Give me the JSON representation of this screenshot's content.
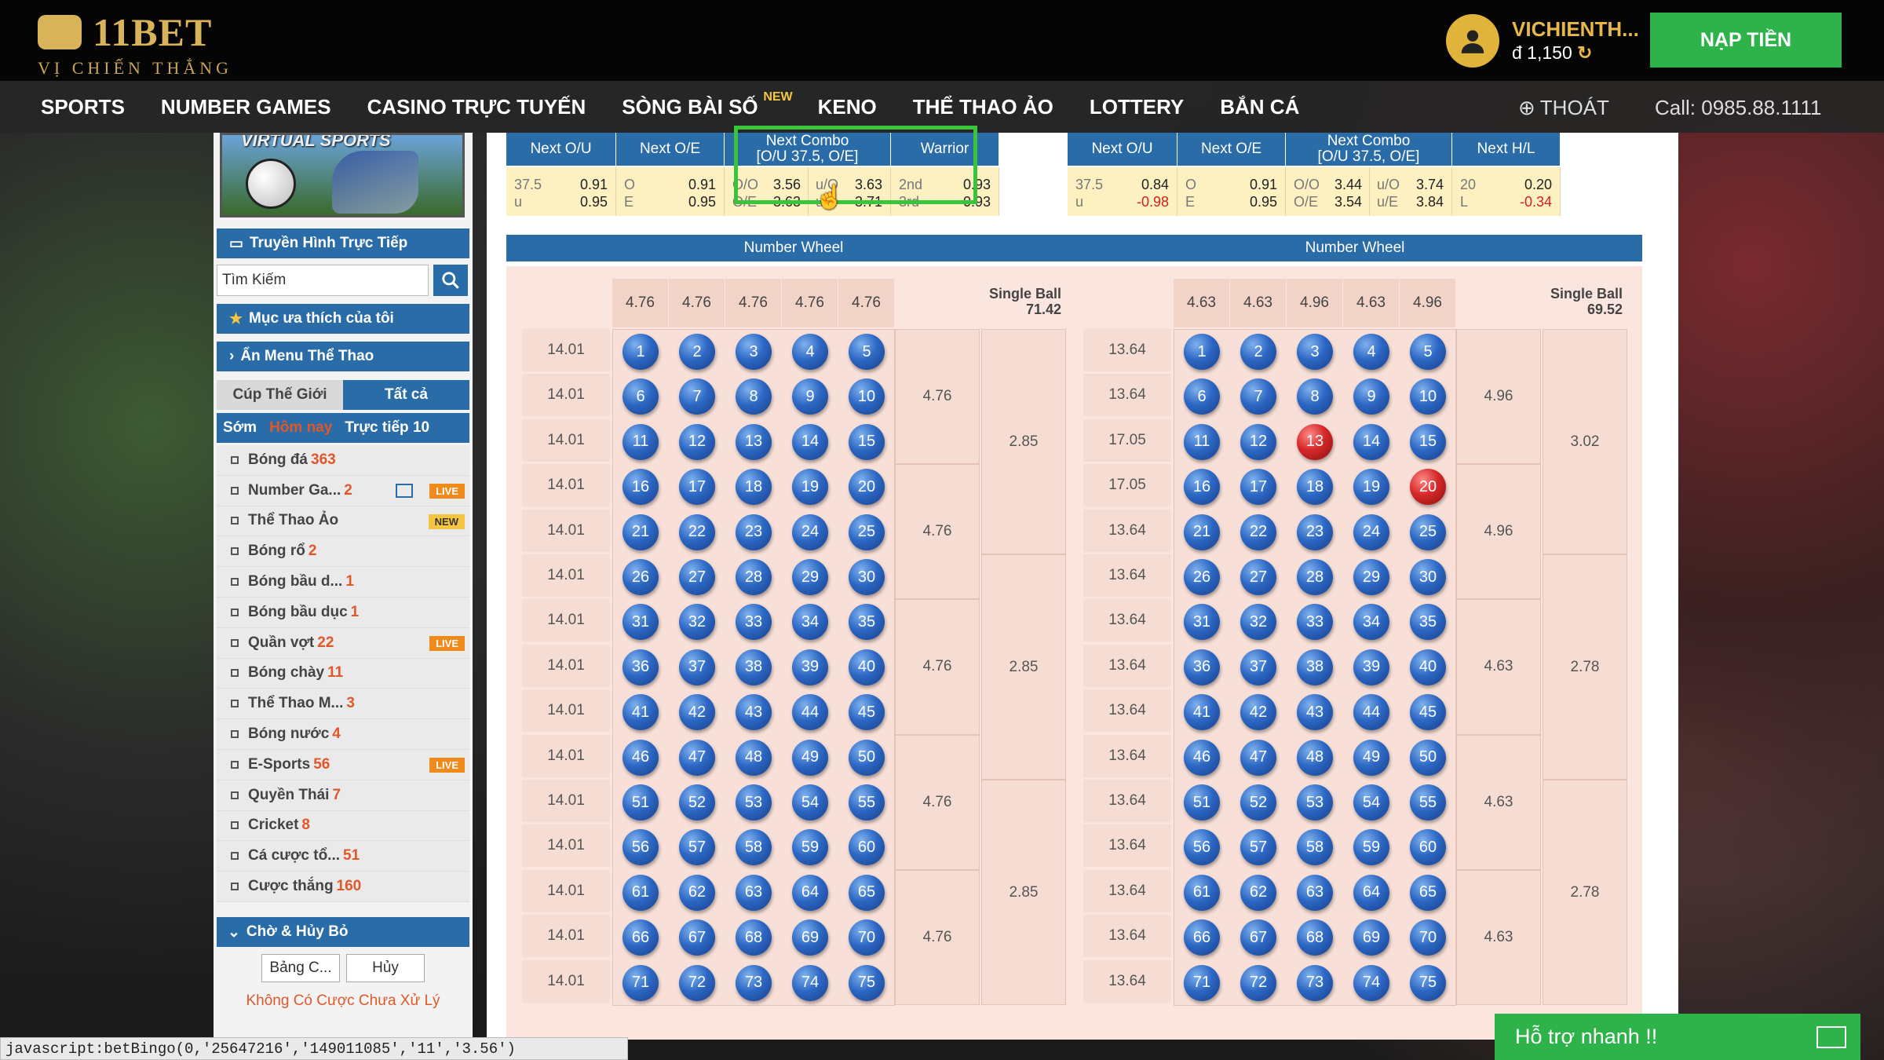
{
  "brand": {
    "name": "11BET",
    "tagline": "VỊ CHIẾN THẮNG"
  },
  "user": {
    "name": "VICHIENTH...",
    "balance": "đ 1,150"
  },
  "deposit_label": "NẠP TIỀN",
  "nav": {
    "items": [
      "SPORTS",
      "NUMBER GAMES",
      "CASINO TRỰC TUYẾN",
      "SÒNG BÀI SỐ",
      "KENO",
      "THỂ THAO ẢO",
      "LOTTERY",
      "BẮN CÁ"
    ],
    "new_badge": "NEW",
    "logout": "THOÁT",
    "call": "Call: 0985.88.1111"
  },
  "sidebar": {
    "banner_title": "VIRTUAL SPORTS",
    "live_tv": "Truyền Hình Trực Tiếp",
    "search_placeholder": "Tìm Kiếm",
    "favorites": "Mục ưa thích của tôi",
    "hide_menu": "Ẩn Menu Thể Thao",
    "tabs": [
      "Cúp Thế Giới",
      "Tất cả"
    ],
    "sub_tabs": [
      "Sớm",
      "Hôm nay",
      "Trực tiếp 10"
    ],
    "sports": [
      {
        "name": "Bóng đá",
        "count": "363",
        "badge": ""
      },
      {
        "name": "Number Ga...",
        "count": "2",
        "badge": "LIVE",
        "cal": true
      },
      {
        "name": "Thể Thao Ảo",
        "count": "",
        "badge": "NEW"
      },
      {
        "name": "Bóng rổ",
        "count": "2",
        "badge": ""
      },
      {
        "name": "Bóng bầu d...",
        "count": "1",
        "badge": ""
      },
      {
        "name": "Bóng bầu dục",
        "count": "1",
        "badge": ""
      },
      {
        "name": "Quần vợt",
        "count": "22",
        "badge": "LIVE"
      },
      {
        "name": "Bóng chày",
        "count": "11",
        "badge": ""
      },
      {
        "name": "Thể Thao M...",
        "count": "3",
        "badge": ""
      },
      {
        "name": "Bóng nước",
        "count": "4",
        "badge": ""
      },
      {
        "name": "E-Sports",
        "count": "56",
        "badge": "LIVE"
      },
      {
        "name": "Quyền Thái",
        "count": "7",
        "badge": ""
      },
      {
        "name": "Cricket",
        "count": "8",
        "badge": ""
      },
      {
        "name": "Cá cược tổ...",
        "count": "51",
        "badge": ""
      },
      {
        "name": "Cược thắng",
        "count": "160",
        "badge": ""
      }
    ],
    "pending_title": "Chờ & Hủy Bỏ",
    "pending_buttons": [
      "Bảng C...",
      "Hủy"
    ],
    "pending_msg": "Không Có Cược Chưa Xử Lý"
  },
  "panels": [
    {
      "headers": [
        "Next O/U",
        "Next O/E",
        "Next Combo\n[O/U 37.5, O/E]",
        "Warrior"
      ],
      "odds": [
        {
          "l": [
            "37.5",
            "u"
          ],
          "r": [
            "0.91",
            "0.95"
          ]
        },
        {
          "l": [
            "O",
            "E"
          ],
          "r": [
            "0.91",
            "0.95"
          ]
        },
        {
          "l": [
            "O/O",
            "O/E"
          ],
          "r": [
            "3.56",
            "3.63"
          ],
          "l2": [
            "u/O",
            "u/E"
          ],
          "r2": [
            "3.63",
            "3.71"
          ]
        },
        {
          "l": [
            "2nd",
            "3rd"
          ],
          "r": [
            "0.93",
            "0.93"
          ]
        }
      ],
      "wheel_title": "Number Wheel",
      "col_odds": [
        "4.76",
        "4.76",
        "4.76",
        "4.76",
        "4.76"
      ],
      "single_ball_label": "Single Ball",
      "single_ball": "71.42",
      "row_odds": [
        "14.01",
        "14.01",
        "14.01",
        "14.01",
        "14.01",
        "14.01",
        "14.01",
        "14.01",
        "14.01",
        "14.01",
        "14.01",
        "14.01",
        "14.01",
        "14.01",
        "14.01"
      ],
      "group_odds": [
        "4.76",
        "4.76",
        "4.76",
        "4.76",
        "4.76"
      ],
      "big_odds": [
        "2.85",
        "2.85",
        "2.85"
      ],
      "red_balls": []
    },
    {
      "headers": [
        "Next O/U",
        "Next O/E",
        "Next Combo\n[O/U 37.5, O/E]",
        "Next H/L"
      ],
      "odds": [
        {
          "l": [
            "37.5",
            "u"
          ],
          "r": [
            "0.84",
            "-0.98"
          ],
          "neg2": true
        },
        {
          "l": [
            "O",
            "E"
          ],
          "r": [
            "0.91",
            "0.95"
          ]
        },
        {
          "l": [
            "O/O",
            "O/E"
          ],
          "r": [
            "3.44",
            "3.54"
          ],
          "l2": [
            "u/O",
            "u/E"
          ],
          "r2": [
            "3.74",
            "3.84"
          ]
        },
        {
          "l": [
            "20",
            "L"
          ],
          "r": [
            "0.20",
            "-0.34"
          ],
          "neg2": true
        }
      ],
      "wheel_title": "Number Wheel",
      "col_odds": [
        "4.63",
        "4.63",
        "4.96",
        "4.63",
        "4.96"
      ],
      "single_ball_label": "Single Ball",
      "single_ball": "69.52",
      "row_odds": [
        "13.64",
        "13.64",
        "17.05",
        "17.05",
        "13.64",
        "13.64",
        "13.64",
        "13.64",
        "13.64",
        "13.64",
        "13.64",
        "13.64",
        "13.64",
        "13.64",
        "13.64"
      ],
      "group_odds": [
        "4.96",
        "4.96",
        "4.63",
        "4.63",
        "4.63"
      ],
      "big_odds": [
        "3.02",
        "2.78",
        "2.78"
      ],
      "red_balls": [
        13,
        20
      ]
    }
  ],
  "status_bar": "javascript:betBingo(0,'25647216','149011085','11','3.56')",
  "support": "Hỗ trợ nhanh !!",
  "colors": {
    "header_blue": "#2a6ca8",
    "odds_yellow": "#fdf1c2",
    "green": "#2eb24a",
    "gold": "#e8b94a",
    "highlight": "#39c43a"
  }
}
